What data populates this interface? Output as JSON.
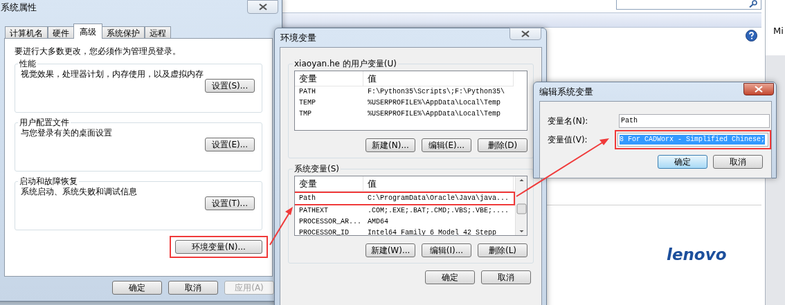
{
  "background_window": {
    "side_text": "Mi",
    "logo": "lenovo"
  },
  "system_properties": {
    "title": "系统属性",
    "tabs": [
      {
        "label": "计算机名",
        "selected": false
      },
      {
        "label": "硬件",
        "selected": false
      },
      {
        "label": "高级",
        "selected": true
      },
      {
        "label": "系统保护",
        "selected": false
      },
      {
        "label": "远程",
        "selected": false
      }
    ],
    "notice": "要进行大多数更改，您必须作为管理员登录。",
    "groups": [
      {
        "title": "性能",
        "description": "视觉效果，处理器计划，内存使用，以及虚拟内存",
        "button": "设置(S)..."
      },
      {
        "title": "用户配置文件",
        "description": "与您登录有关的桌面设置",
        "button": "设置(E)..."
      },
      {
        "title": "启动和故障恢复",
        "description": "系统启动、系统失败和调试信息",
        "button": "设置(T)..."
      }
    ],
    "env_button": {
      "label": "环境变量(N)...",
      "marked": true
    },
    "buttons": [
      {
        "label": "确定",
        "disabled": false
      },
      {
        "label": "取消",
        "disabled": false
      },
      {
        "label": "应用(A)",
        "disabled": true
      }
    ]
  },
  "environment_variables": {
    "title": "环境变量",
    "sections": [
      {
        "title": "xiaoyan.he 的用户变量(U)",
        "columns": [
          "变量",
          "值"
        ],
        "rows": [
          {
            "name": "PATH",
            "value": "F:\\Python35\\Scripts\\;F:\\Python35\\",
            "selected": false
          },
          {
            "name": "TEMP",
            "value": "%USERPROFILE%\\AppData\\Local\\Temp",
            "selected": false
          },
          {
            "name": "TMP",
            "value": "%USERPROFILE%\\AppData\\Local\\Temp",
            "selected": false
          }
        ],
        "buttons": [
          "新建(N)...",
          "编辑(E)...",
          "删除(D)"
        ]
      },
      {
        "title": "系统变量(S)",
        "columns": [
          "变量",
          "值"
        ],
        "rows": [
          {
            "name": "Path",
            "value": "C:\\ProgramData\\Oracle\\Java\\java...",
            "selected": false,
            "marked": true
          },
          {
            "name": "PATHEXT",
            "value": ".COM;.EXE;.BAT;.CMD;.VBS;.VBE;....",
            "selected": false
          },
          {
            "name": "PROCESSOR_AR...",
            "value": "AMD64",
            "selected": false
          },
          {
            "name": "PROCESSOR_ID",
            "value": "Intel64 Family 6 Model 42 Stepp",
            "selected": false
          }
        ],
        "buttons": [
          "新建(W)...",
          "编辑(I)...",
          "删除(L)"
        ]
      }
    ],
    "buttons": [
      "确定",
      "取消"
    ]
  },
  "edit_dialog": {
    "title": "编辑系统变量",
    "name_label": "变量名(N):",
    "name_value": "Path",
    "value_label": "变量值(V):",
    "value_value": "8 For CADWorx - Simplified Chinese;",
    "value_selected": true,
    "value_marked": true,
    "buttons": [
      {
        "label": "确定",
        "default": true
      },
      {
        "label": "取消",
        "default": false
      }
    ]
  }
}
